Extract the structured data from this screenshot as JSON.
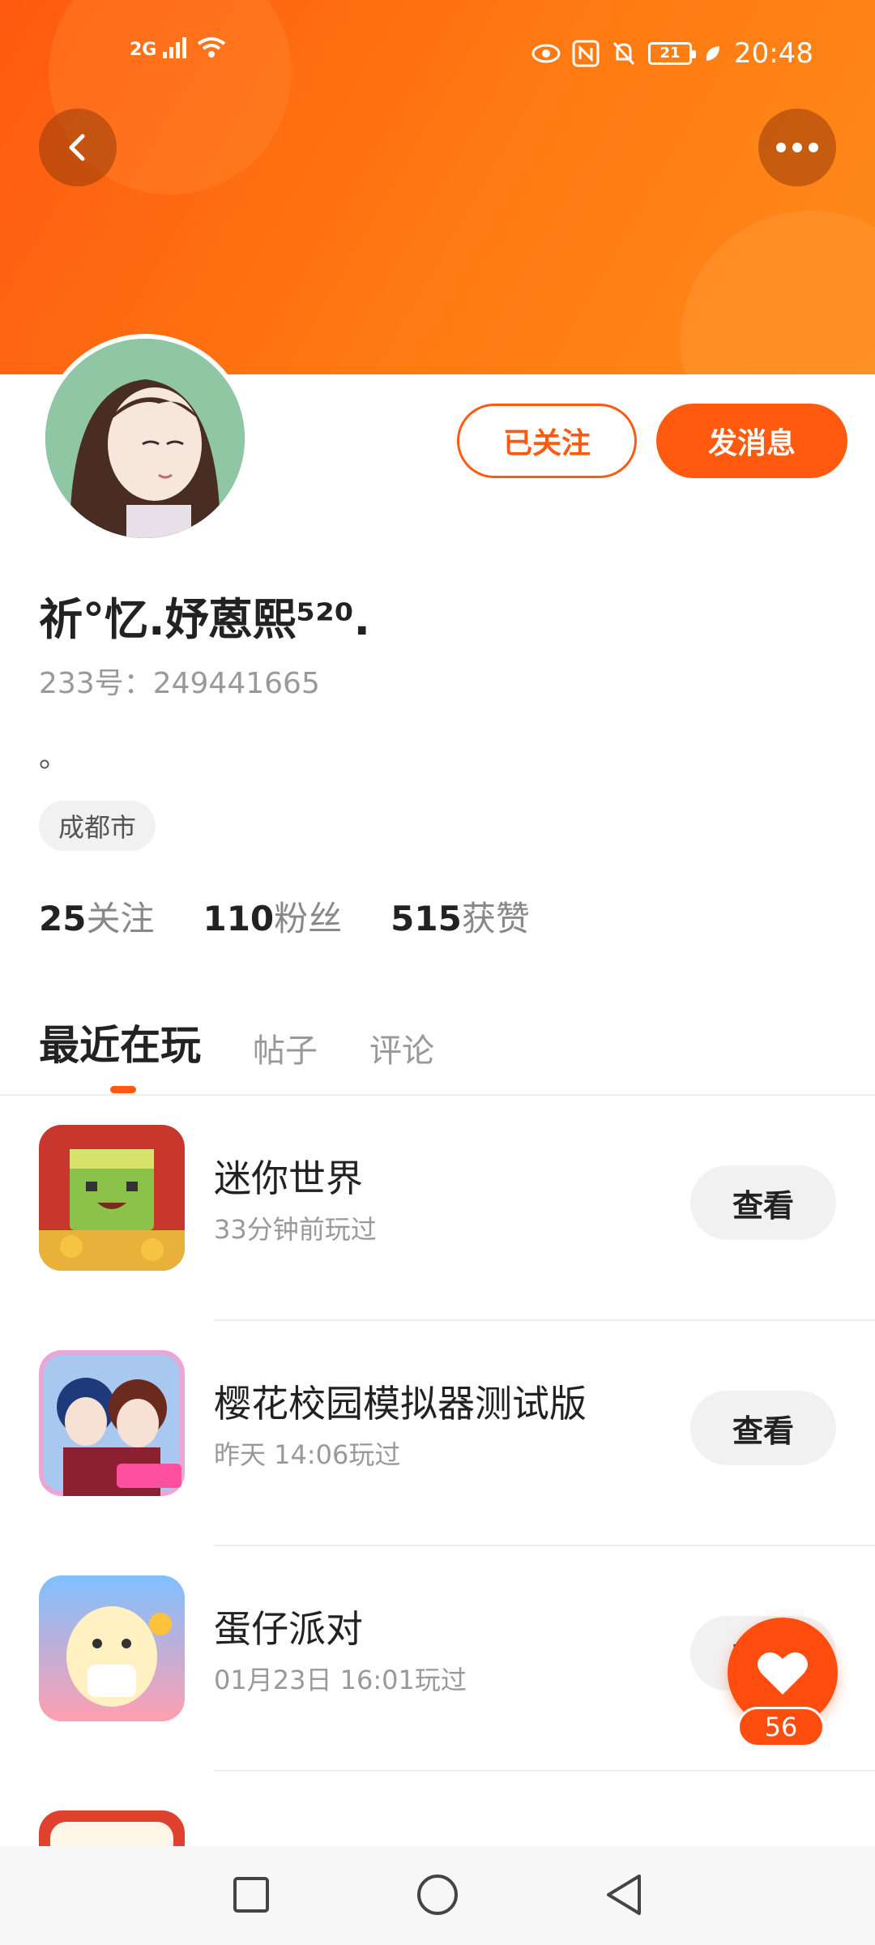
{
  "status_bar": {
    "network": "2G",
    "battery": "21",
    "time": "20:48"
  },
  "profile": {
    "nickname": "祈°忆.妤蒽熙⁵²⁰.",
    "uid_label": "233号：",
    "uid": "249441665",
    "bio": "。",
    "location": "成都市",
    "follow_button": "已关注",
    "message_button": "发消息"
  },
  "stats": [
    {
      "value": "25",
      "label": "关注"
    },
    {
      "value": "110",
      "label": "粉丝"
    },
    {
      "value": "515",
      "label": "获赞"
    }
  ],
  "tabs": [
    {
      "label": "最近在玩",
      "active": true
    },
    {
      "label": "帖子",
      "active": false
    },
    {
      "label": "评论",
      "active": false
    }
  ],
  "games": [
    {
      "title": "迷你世界",
      "time": "33分钟前玩过",
      "button": "查看"
    },
    {
      "title": "樱花校园模拟器测试版",
      "time": "昨天 14:06玩过",
      "button": "查看"
    },
    {
      "title": "蛋仔派对",
      "time": "01月23日 16:01玩过",
      "button": "查看"
    }
  ],
  "like_fab": {
    "count": "56"
  },
  "icons": {
    "back": "chevron-left-icon",
    "more": "more-dots-icon",
    "like": "heart-icon"
  },
  "colors": {
    "accent": "#ff5a10",
    "banner_start": "#ff5a10",
    "banner_end": "#ff8a1a"
  }
}
